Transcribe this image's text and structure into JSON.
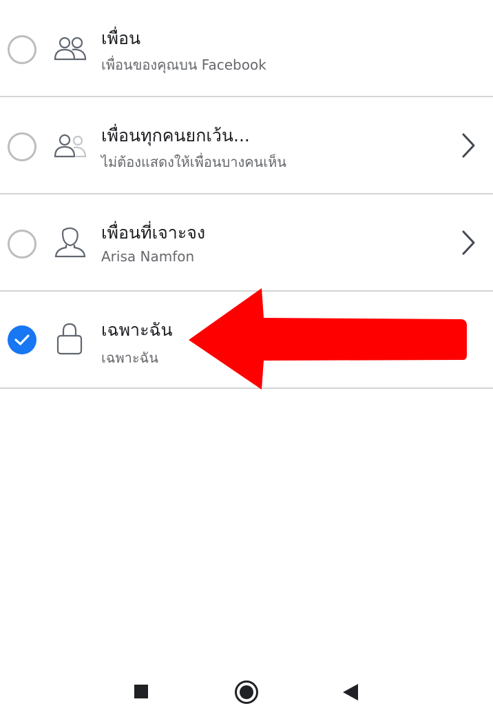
{
  "options": [
    {
      "title": "เพื่อน",
      "subtitle": "เพื่อนของคุณบน Facebook",
      "icon": "friends-icon",
      "selected": false,
      "has_chevron": false
    },
    {
      "title": "เพื่อนทุกคนยกเว้น...",
      "subtitle": "ไม่ต้องแสดงให้เพื่อนบางคนเห็น",
      "icon": "friends-except-icon",
      "selected": false,
      "has_chevron": true
    },
    {
      "title": "เพื่อนที่เจาะจง",
      "subtitle": "Arisa Namfon",
      "icon": "specific-friend-icon",
      "selected": false,
      "has_chevron": true
    },
    {
      "title": "เฉพาะฉัน",
      "subtitle": "เฉพาะฉัน",
      "icon": "lock-icon",
      "selected": true,
      "has_chevron": false
    }
  ],
  "colors": {
    "accent": "#1877f2",
    "annotation_arrow": "#ff0000",
    "divider": "#d4d4d4"
  },
  "nav": {
    "icons": [
      "recent-apps-icon",
      "home-icon",
      "back-icon"
    ]
  }
}
